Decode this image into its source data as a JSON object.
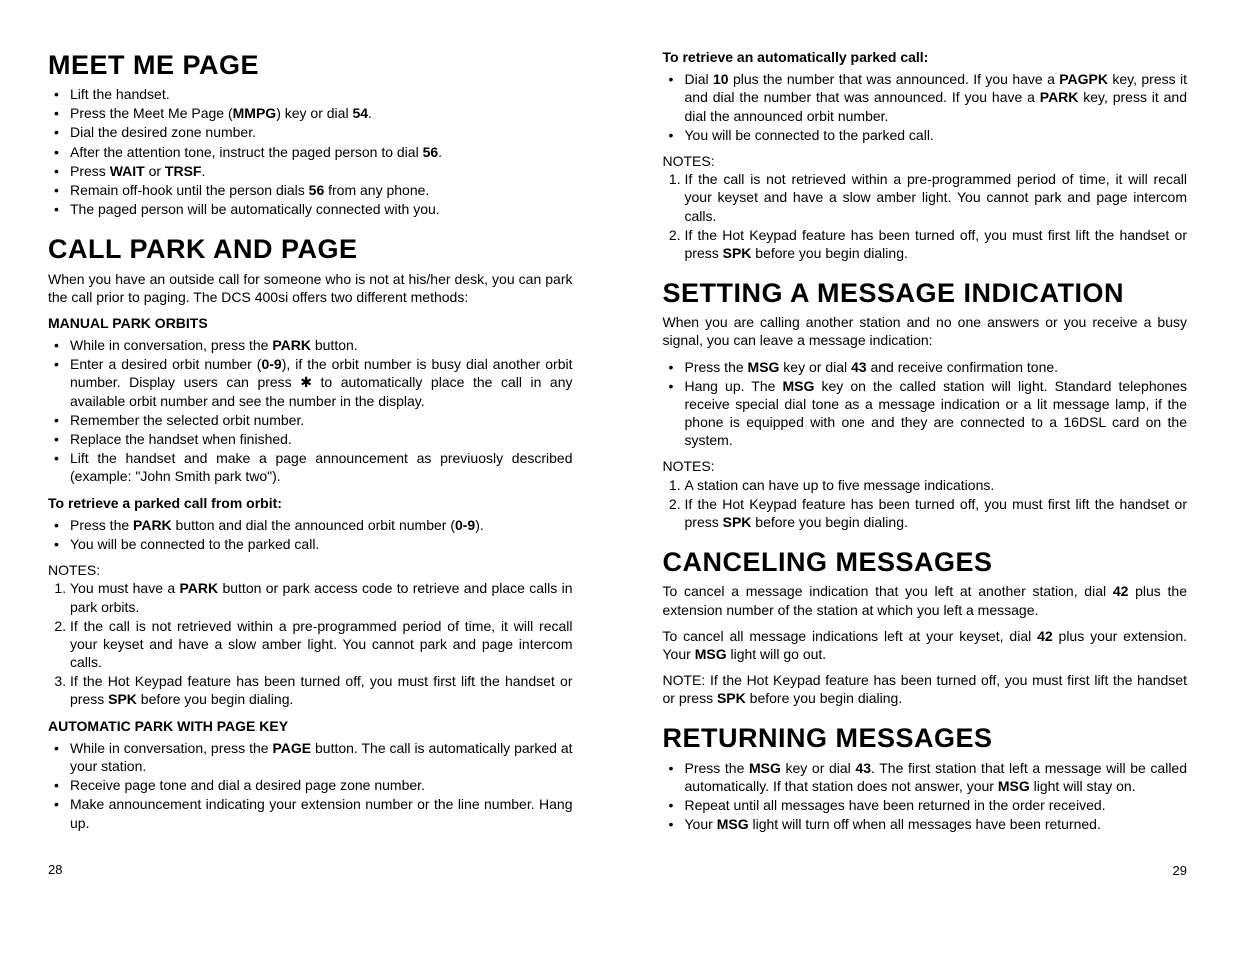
{
  "left": {
    "meet_me_page": {
      "title": "MEET ME PAGE",
      "items": [
        "Lift the handset.",
        "Press the Meet Me Page (<b>MMPG</b>) key or dial <b>54</b>.",
        "Dial the desired zone number.",
        "After the attention tone, instruct the paged person to dial <b>56</b>.",
        "Press <b>WAIT</b> or <b>TRSF</b>.",
        "Remain off-hook until the person dials <b>56</b> from any phone.",
        "The paged person will be automatically connected with you."
      ]
    },
    "call_park_and_page": {
      "title": "CALL PARK AND PAGE",
      "intro": "When you have an outside call for someone who is not at his/her desk, you can park the call prior to paging. The DCS 400si offers two different methods:",
      "manual_sub": "MANUAL PARK ORBITS",
      "manual_items": [
        "While in conversation, press the <b>PARK</b> button.",
        "Enter a desired orbit number (<b>0-9</b>), if the orbit number is busy dial another orbit number. Display users can press ✱ to automatically place the call in any available orbit number and see the number in the display.",
        "Remember the selected orbit number.",
        "Replace the handset when finished.",
        "Lift the handset and make a page announcement as previuosly described (example: \"John Smith park two\")."
      ],
      "retrieve_sub": "To retrieve a parked call from orbit:",
      "retrieve_items": [
        "Press the <b>PARK</b> button and dial the announced orbit number (<b>0-9</b>).",
        "You will be connected to the parked call."
      ],
      "notes_label": "NOTES:",
      "notes": [
        "You must have a <b>PARK</b> button or park access code to retrieve and place calls in park orbits.",
        "If the call is not retrieved within a pre-programmed period of time, it will recall your keyset and have a slow amber light. You cannot park and page intercom calls.",
        "If the Hot Keypad feature has been turned off, you must first lift the handset or press <b>SPK</b> before you begin dialing."
      ],
      "auto_sub": "AUTOMATIC PARK WITH PAGE KEY",
      "auto_items": [
        "While in conversation, press the <b>PAGE</b> button. The call is automatically parked at your station.",
        "Receive page tone and dial a desired page zone number.",
        "Make announcement indicating your extension number or the line number. Hang up."
      ]
    },
    "page_num": "28"
  },
  "right": {
    "retrieve_auto": {
      "sub": "To retrieve an automatically parked call:",
      "items": [
        "Dial <b>10</b> plus the number that was announced. If you have a <b>PAGPK</b> key, press it and dial the number that was announced. If you have a <b>PARK</b> key, press it and dial the announced orbit number.",
        "You will be connected to the parked call."
      ],
      "notes_label": "NOTES:",
      "notes": [
        "If the call is not retrieved within a pre-programmed period of time, it will recall your keyset and have a slow amber light. You cannot park and page intercom calls.",
        "If the Hot Keypad feature has been turned off, you must first lift the handset or press <b>SPK</b> before you begin dialing."
      ]
    },
    "setting_msg": {
      "title": "SETTING A MESSAGE INDICATION",
      "intro": "When you are calling another station and no one answers or you receive a busy signal, you can leave a message indication:",
      "items": [
        "Press the <b>MSG</b> key or dial <b>43</b> and receive confirmation tone.",
        "Hang up. The <b>MSG</b> key on the called station will light. Standard telephones receive special dial tone as a message indication or a lit message lamp, if the phone is equipped with one and they are connected to a 16DSL card on the system."
      ],
      "notes_label": "NOTES:",
      "notes": [
        "A station can have up to five message indications.",
        "If the Hot Keypad feature has been turned off, you must first lift the handset or press <b>SPK</b> before you begin dialing."
      ]
    },
    "canceling": {
      "title": "CANCELING MESSAGES",
      "p1": "To cancel a message indication that you left at another station, dial <b>42</b> plus the extension number of the station at which you left a message.",
      "p2": "To cancel all message indications left at your keyset, dial <b>42</b> plus your extension. Your <b>MSG</b> light will go out.",
      "p3": "NOTE:  If the Hot Keypad feature has been turned off, you must first lift the handset or press <b>SPK</b> before you begin dialing."
    },
    "returning": {
      "title": "RETURNING MESSAGES",
      "items": [
        "Press the <b>MSG</b> key or dial <b>43</b>. The first station that left a message will be called automatically. If that station does not answer, your <b>MSG</b> light will stay on.",
        "Repeat until all messages have been returned in the order received.",
        "Your <b>MSG</b> light will turn off when all messages have been returned."
      ]
    },
    "page_num": "29"
  }
}
